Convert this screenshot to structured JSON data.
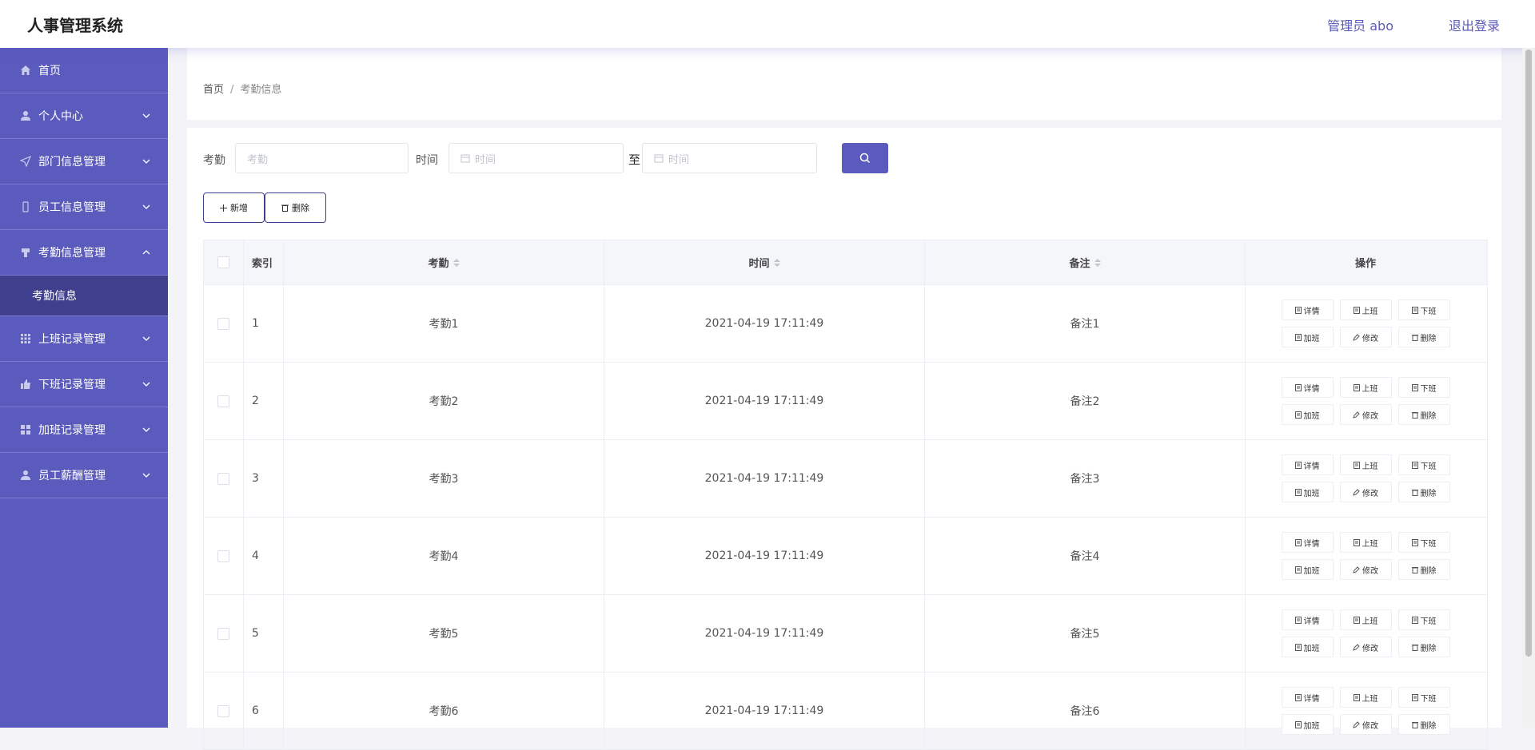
{
  "header": {
    "title": "人事管理系统",
    "user": "管理员 abo",
    "logout": "退出登录"
  },
  "sidebar": {
    "items": [
      {
        "label": "首页",
        "icon": "home-icon"
      },
      {
        "label": "个人中心",
        "icon": "user-icon"
      },
      {
        "label": "部门信息管理",
        "icon": "send-icon"
      },
      {
        "label": "员工信息管理",
        "icon": "phone-icon"
      },
      {
        "label": "考勤信息管理",
        "icon": "flag-icon",
        "open": true
      },
      {
        "label": "上班记录管理",
        "icon": "grid-icon"
      },
      {
        "label": "下班记录管理",
        "icon": "thumb-icon"
      },
      {
        "label": "加班记录管理",
        "icon": "apps-icon"
      },
      {
        "label": "员工薪酬管理",
        "icon": "user-icon"
      }
    ],
    "submenu": [
      "考勤信息"
    ]
  },
  "breadcrumb": {
    "home": "首页",
    "sep": "/",
    "current": "考勤信息"
  },
  "filters": {
    "kq_label": "考勤",
    "kq_placeholder": "考勤",
    "time_label": "时间",
    "time_start_placeholder": "时间",
    "to_label": "至",
    "time_end_placeholder": "时间"
  },
  "actions": {
    "add": "新增",
    "delete": "删除"
  },
  "table": {
    "headers": {
      "index": "索引",
      "kq": "考勤",
      "time": "时间",
      "note": "备注",
      "ops": "操作"
    },
    "ops": {
      "detail": "详情",
      "on": "上班",
      "off": "下班",
      "overtime": "加班",
      "edit": "修改",
      "delete": "删除"
    },
    "rows": [
      {
        "index": "1",
        "kq": "考勤1",
        "time": "2021-04-19 17:11:49",
        "note": "备注1"
      },
      {
        "index": "2",
        "kq": "考勤2",
        "time": "2021-04-19 17:11:49",
        "note": "备注2"
      },
      {
        "index": "3",
        "kq": "考勤3",
        "time": "2021-04-19 17:11:49",
        "note": "备注3"
      },
      {
        "index": "4",
        "kq": "考勤4",
        "time": "2021-04-19 17:11:49",
        "note": "备注4"
      },
      {
        "index": "5",
        "kq": "考勤5",
        "time": "2021-04-19 17:11:49",
        "note": "备注5"
      },
      {
        "index": "6",
        "kq": "考勤6",
        "time": "2021-04-19 17:11:49",
        "note": "备注6"
      }
    ]
  },
  "colors": {
    "accent": "#5b5bbd",
    "active_sub": "#3f3f8e",
    "header_text": "#5a5ab8"
  }
}
